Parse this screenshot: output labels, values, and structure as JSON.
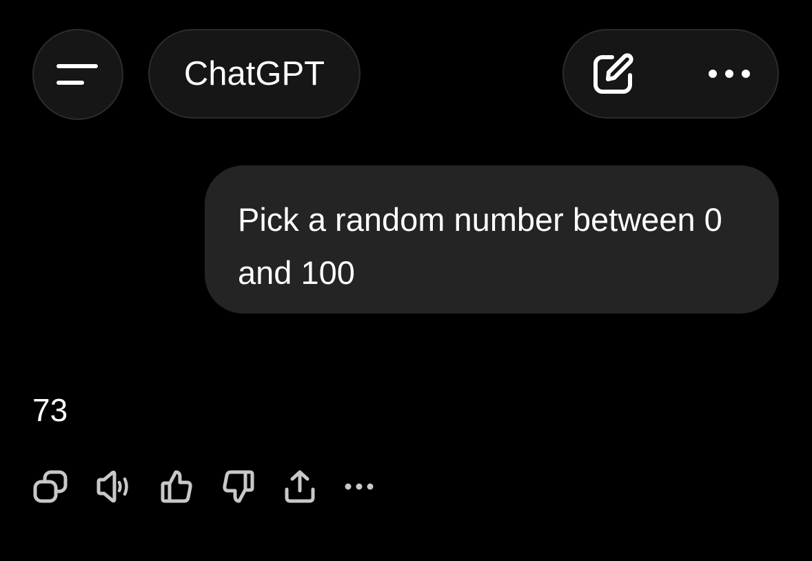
{
  "header": {
    "menu_icon": "hamburger-icon",
    "title": "ChatGPT",
    "new_chat_icon": "edit-icon",
    "more_icon": "more-horizontal-icon"
  },
  "conversation": {
    "user_message": "Pick a random number between 0 and 100",
    "assistant_message": "73"
  },
  "message_actions": [
    {
      "icon": "copy-icon"
    },
    {
      "icon": "speaker-icon"
    },
    {
      "icon": "thumbs-up-icon"
    },
    {
      "icon": "thumbs-down-icon"
    },
    {
      "icon": "share-icon"
    },
    {
      "icon": "more-horizontal-icon"
    }
  ],
  "colors": {
    "background": "#000000",
    "pill_background": "#161616",
    "bubble_background": "#242424",
    "icon_color": "#c8c8c8",
    "text": "#ffffff"
  }
}
